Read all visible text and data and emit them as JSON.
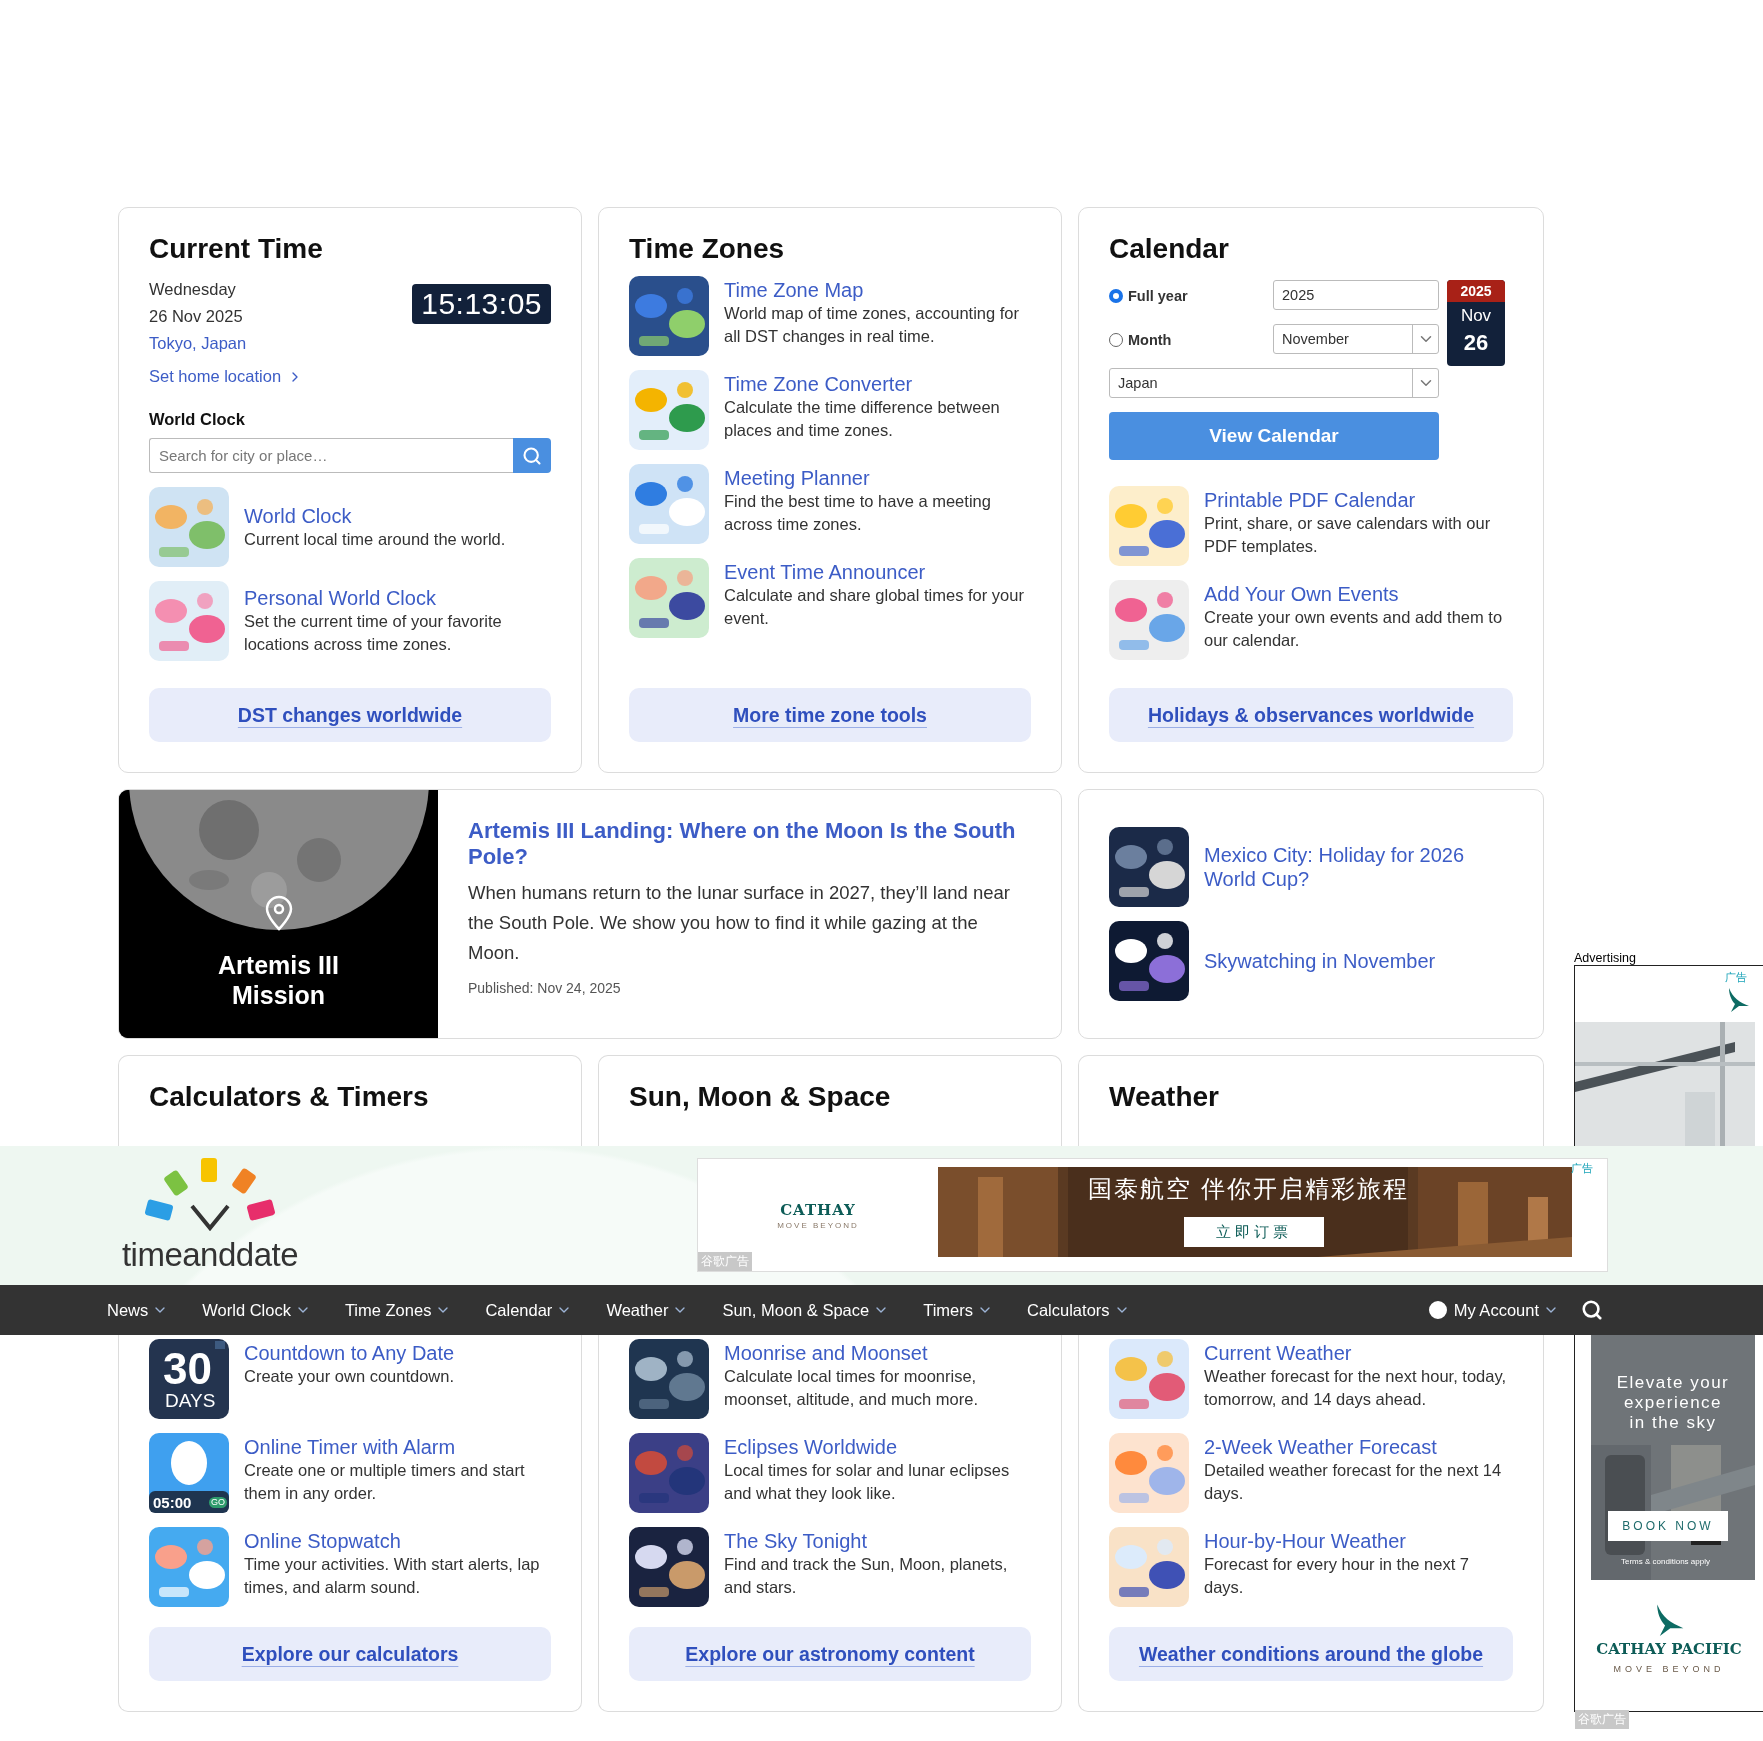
{
  "current_time": {
    "title": "Current Time",
    "weekday": "Wednesday",
    "date": "26 Nov 2025",
    "location": "Tokyo, Japan",
    "home_link": "Set home location",
    "clock": "15:13:05",
    "world_clock_label": "World Clock",
    "search": {
      "placeholder": "Search for city or place…"
    },
    "items": [
      {
        "title": "World Clock",
        "desc": "Current local time around the world."
      },
      {
        "title": "Personal World Clock",
        "desc": "Set the current time of your favorite locations across time zones."
      }
    ],
    "button": "DST changes worldwide"
  },
  "time_zones": {
    "title": "Time Zones",
    "items": [
      {
        "title": "Time Zone Map",
        "desc": "World map of time zones, accounting for all DST changes in real time."
      },
      {
        "title": "Time Zone Converter",
        "desc": "Calculate the time difference between places and time zones."
      },
      {
        "title": "Meeting Planner",
        "desc": "Find the best time to have a meeting across time zones."
      },
      {
        "title": "Event Time Announcer",
        "desc": "Calculate and share global times for your event."
      }
    ],
    "button": "More time zone tools"
  },
  "calendar": {
    "title": "Calendar",
    "options": [
      {
        "label": "Full year",
        "selected": true
      },
      {
        "label": "Month",
        "selected": false
      }
    ],
    "year_field": "2025",
    "month_select": "November",
    "country_select": "Japan",
    "date_badge": {
      "year": "2025",
      "month": "Nov",
      "day": "26"
    },
    "view_button": "View Calendar",
    "items": [
      {
        "title": "Printable PDF Calendar",
        "desc": "Print, share, or save calendars with our PDF templates."
      },
      {
        "title": "Add Your Own Events",
        "desc": "Create your own events and add them to our calendar."
      }
    ],
    "button": "Holidays & observances worldwide"
  },
  "article": {
    "image_caption": "Artemis III Mission",
    "title": "Artemis III Landing: Where on the Moon Is the South Pole?",
    "body": "When humans return to the lunar surface in 2027, they’ll land near the South Pole. We show you how to find it while gazing at the Moon.",
    "published": "Published: Nov 24, 2025"
  },
  "side_links": [
    {
      "title": "Mexico City: Holiday for 2026 World Cup?"
    },
    {
      "title": "Skywatching in November"
    }
  ],
  "lower_titles": [
    "Calculators & Timers",
    "Sun, Moon & Space",
    "Weather"
  ],
  "header": {
    "logo": "timeanddate",
    "banner": {
      "tag": "广告",
      "brand": "CATHAY",
      "slogan": "MOVE BEYOND",
      "headline": "国泰航空 伴你开启精彩旅程",
      "button": "立即订票",
      "source": "谷歌广告"
    },
    "nav": [
      {
        "label": "News"
      },
      {
        "label": "World Clock"
      },
      {
        "label": "Time Zones"
      },
      {
        "label": "Calendar"
      },
      {
        "label": "Weather"
      },
      {
        "label": "Sun, Moon & Space"
      },
      {
        "label": "Timers"
      },
      {
        "label": "Calculators"
      }
    ],
    "account": "My Account"
  },
  "lower_cards": [
    {
      "items": [
        {
          "title": "Countdown to Any Date",
          "desc": "Create your own countdown.",
          "thumb_text": [
            "30",
            "DAYS"
          ]
        },
        {
          "title": "Online Timer with Alarm",
          "desc": "Create one or multiple timers and start them in any order.",
          "thumb_text": [
            "05:00",
            "GO"
          ]
        },
        {
          "title": "Online Stopwatch",
          "desc": "Time your activities. With start alerts, lap times, and alarm sound."
        }
      ],
      "button": "Explore our calculators"
    },
    {
      "items": [
        {
          "title": "Moonrise and Moonset",
          "desc": "Calculate local times for moonrise, moonset, altitude, and much more."
        },
        {
          "title": "Eclipses Worldwide",
          "desc": "Local times for solar and lunar eclipses and what they look like."
        },
        {
          "title": "The Sky Tonight",
          "desc": "Find and track the Sun, Moon, planets, and stars."
        }
      ],
      "button": "Explore our astronomy content"
    },
    {
      "items": [
        {
          "title": "Current Weather",
          "desc": "Weather forecast for the next hour, today, tomorrow, and 14 days ahead."
        },
        {
          "title": "2-Week Weather Forecast",
          "desc": "Detailed weather forecast for the next 14 days."
        },
        {
          "title": "Hour-by-Hour Weather",
          "desc": "Forecast for every hour in the next 7 days."
        }
      ],
      "button": "Weather conditions around the globe"
    }
  ],
  "side_ad": {
    "label": "Advertising",
    "tag": "广告",
    "headline": "Elevate your experience in the sky",
    "button": "BOOK NOW",
    "terms": "Terms & conditions apply",
    "brand": "CATHAY PACIFIC",
    "slogan": "MOVE BEYOND",
    "source": "谷歌广告"
  }
}
